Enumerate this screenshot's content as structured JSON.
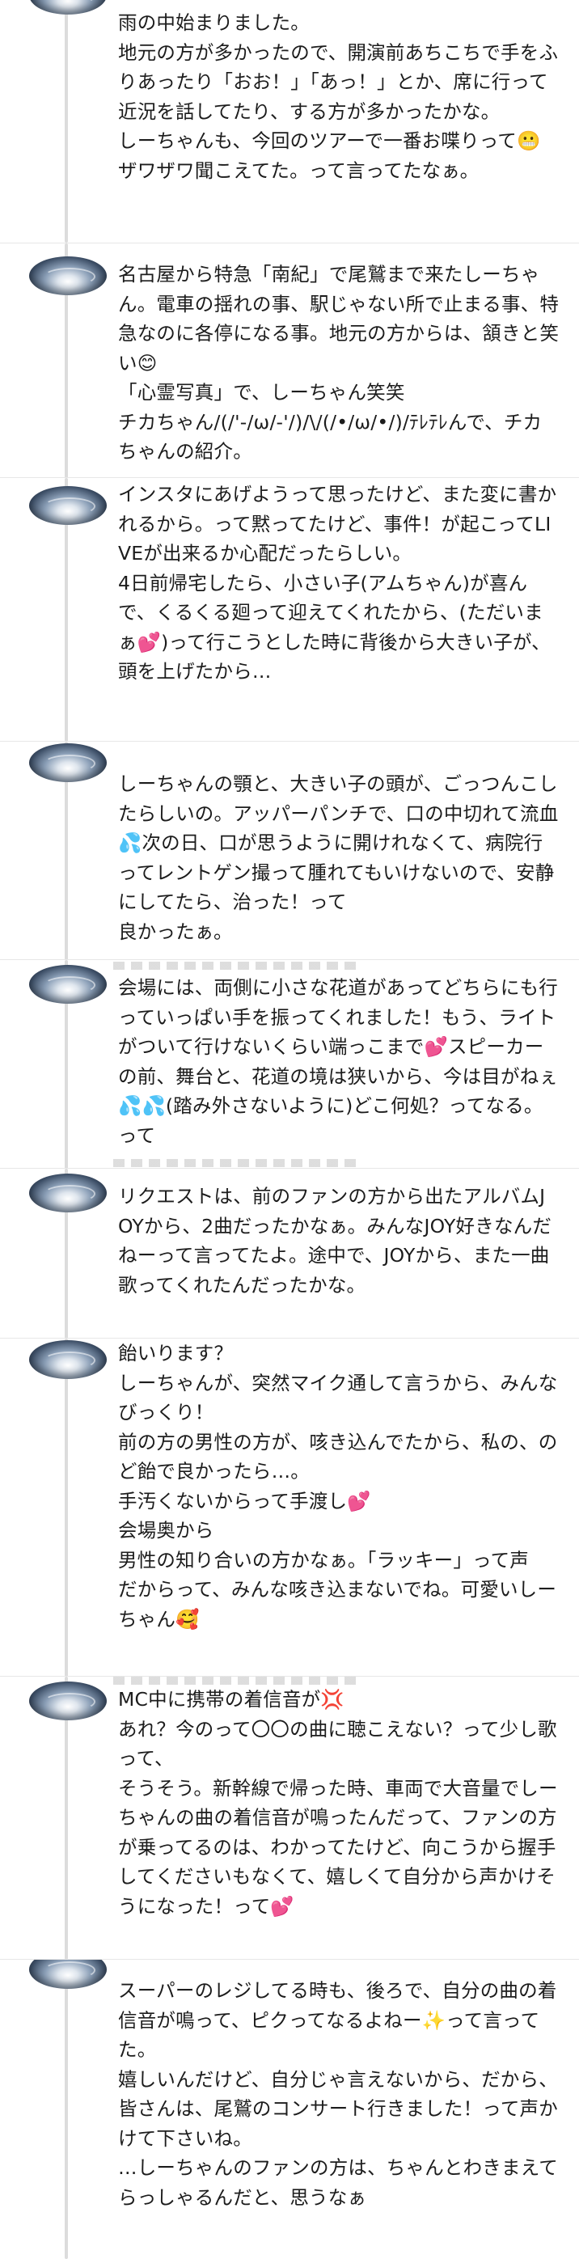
{
  "posts": [
    {
      "text": "雨の中始まりました。\n地元の方が多かったので、開演前あちこちで手をふりあったり「おお！」「あっ！」とか、席に行って近況を話してたり、する方が多かったかな。\nしーちゃんも、今回のツアーで一番お喋りって😬ザワザワ聞こえてた。って言ってたなぁ。"
    },
    {
      "text": "名古屋から特急「南紀」で尾鷲まで来たしーちゃん。電車の揺れの事、駅じゃない所で止まる事、特急なのに各停になる事。地元の方からは、頷きと笑い😊\n「心霊写真」で、しーちゃん笑笑\nチカちゃん/(/'-/ω/-'/)/\\/(/•/ω/•/)/ﾃﾚﾃﾚんで、チカちゃんの紹介。"
    },
    {
      "text": "インスタにあげようって思ったけど、また変に書かれるから。って黙ってたけど、事件！が起こってLIVEが出来るか心配だったらしい。\n4日前帰宅したら、小さい子(アムちゃん)が喜んで、くるくる廻って迎えてくれたから、(ただいまぁ💕)って行こうとした時に背後から大きい子が、頭を上げたから…"
    },
    {
      "text": "しーちゃんの顎と、大きい子の頭が、ごっつんこしたらしいの。アッパーパンチで、口の中切れて流血💦次の日、口が思うように開けれなくて、病院行ってレントゲン撮って腫れてもいけないので、安静にしてたら、治った！って\n良かったぁ。"
    },
    {
      "text": "会場には、両側に小さな花道があってどちらにも行っていっぱい手を振ってくれました！もう、ライトがついて行けないくらい端っこまで💕スピーカーの前、舞台と、花道の境は狭いから、今は目がねぇ💦💦(踏み外さないように)どこ何処？ってなる。って"
    },
    {
      "text": "リクエストは、前のファンの方から出たアルバムJOYから、2曲だったかなぁ。みんなJOY好きなんだねーって言ってたよ。途中で、JOYから、また一曲歌ってくれたんだったかな。"
    },
    {
      "text": "飴いります？\nしーちゃんが、突然マイク通して言うから、みんなびっくり！\n前の方の男性の方が、咳き込んでたから、私の、のど飴で良かったら…。\n手汚くないからって手渡し💕\n会場奥から\n男性の知り合いの方かなぁ。「ラッキー」って声\nだからって、みんな咳き込まないでね。可愛いしーちゃん🥰"
    },
    {
      "text": "MC中に携帯の着信音が💢\nあれ？今のって〇〇の曲に聴こえない？って少し歌って、\nそうそう。新幹線で帰った時、車両で大音量でしーちゃんの曲の着信音が鳴ったんだって、ファンの方が乗ってるのは、わかってたけど、向こうから握手してくださいもなくて、嬉しくて自分から声かけそうになった！って💕"
    },
    {
      "text": "スーパーのレジしてる時も、後ろで、自分の曲の着信音が鳴って、ピクってなるよねー✨って言ってた。\n嬉しいんだけど、自分じゃ言えないから、だから、\n皆さんは、尾鷲のコンサート行きました！って声かけて下さいね。\n…しーちゃんのファンの方は、ちゃんとわきまえてらっしゃるんだと、思うなぁ"
    }
  ]
}
